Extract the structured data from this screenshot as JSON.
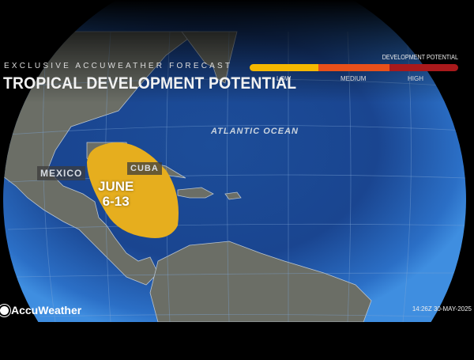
{
  "header": {
    "kicker": "EXCLUSIVE ACCUWEATHER FORECAST",
    "title": "TROPICAL DEVELOPMENT POTENTIAL"
  },
  "legend": {
    "title": "DEVELOPMENT POTENTIAL",
    "levels": [
      {
        "label": "LOW",
        "color": "#f5b800"
      },
      {
        "label": "MEDIUM",
        "color": "#e8501a"
      },
      {
        "label": "HIGH",
        "color": "#a8191b"
      }
    ]
  },
  "map": {
    "labels": {
      "mexico": "MEXICO",
      "cuba": "CUBA",
      "ocean": "ATLANTIC OCEAN"
    },
    "zone": {
      "period_line1": "JUNE",
      "period_line2": "6-13",
      "level": "LOW",
      "color": "#e6ae1e"
    }
  },
  "footer": {
    "brand": "AccuWeather",
    "timestamp": "14:26Z 30-MAY-2025"
  }
}
